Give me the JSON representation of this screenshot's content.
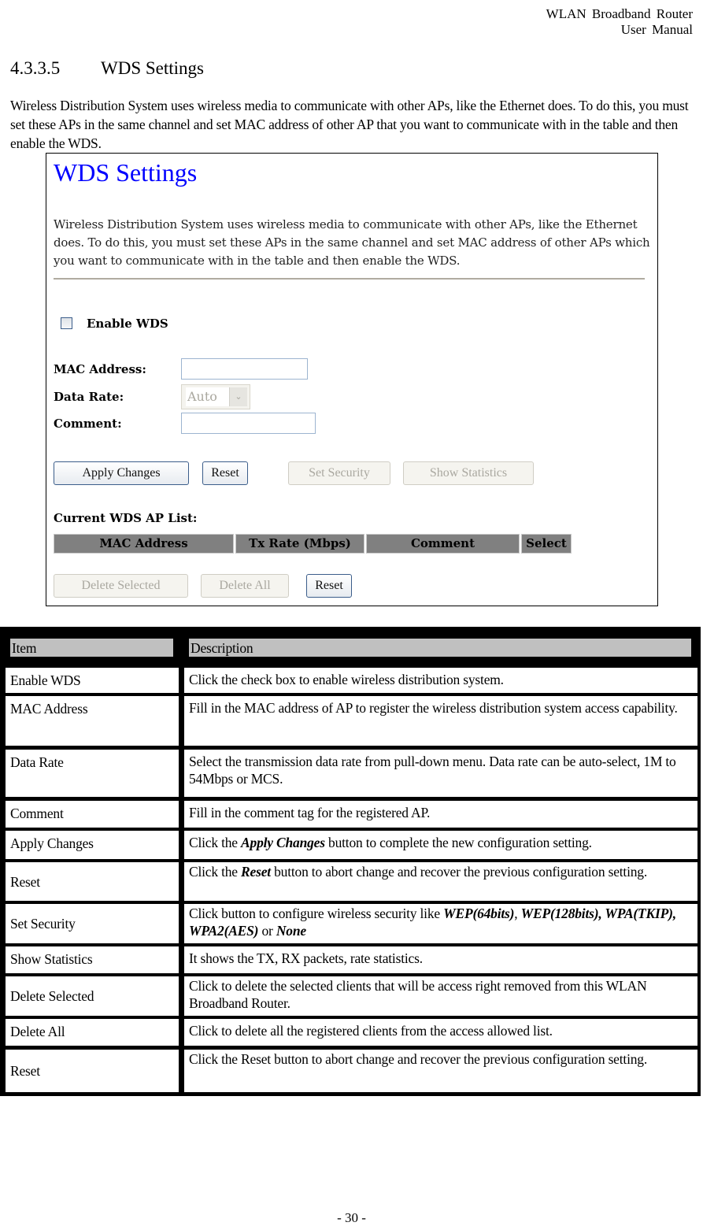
{
  "running_header": {
    "line1": "WLAN  Broadband  Router",
    "line2": "User  Manual"
  },
  "section": {
    "number": "4.3.3.5",
    "title": "WDS Settings"
  },
  "intro": "Wireless Distribution System uses wireless media to communicate with other APs, like the Ethernet does. To do this, you must set these APs in the same channel and set MAC address of other AP that you want to communicate with in the table and then enable the WDS.",
  "screenshot": {
    "title": "WDS Settings",
    "description": "Wireless Distribution System uses wireless media to communicate with other APs, like the Ethernet does. To do this, you must set these APs in the same channel and set MAC address of other APs which you want to communicate with in the table and then enable the WDS.",
    "enable_wds": {
      "label": "Enable WDS",
      "checked": false
    },
    "fields": {
      "mac_address": {
        "label": "MAC Address:",
        "value": ""
      },
      "data_rate": {
        "label": "Data Rate:",
        "selected": "Auto",
        "disabled": true
      },
      "comment": {
        "label": "Comment:",
        "value": ""
      }
    },
    "buttons": {
      "apply_changes": "Apply Changes",
      "reset": "Reset",
      "set_security": "Set Security",
      "show_statistics": "Show Statistics"
    },
    "ap_list": {
      "label": "Current WDS AP List:",
      "columns": [
        "MAC Address",
        "Tx Rate (Mbps)",
        "Comment",
        "Select"
      ],
      "rows": []
    },
    "list_buttons": {
      "delete_selected": "Delete Selected",
      "delete_all": "Delete All",
      "reset": "Reset"
    },
    "colors": {
      "title": "#0000ff",
      "list_header_bg": "#808080"
    }
  },
  "table": {
    "headers": {
      "item": "Item",
      "description": "Description"
    },
    "rows": [
      {
        "item": "Enable WDS",
        "description": [
          "Click the check box to enable wireless distribution system."
        ]
      },
      {
        "item": "MAC Address",
        "description": [
          "Fill in the MAC address of AP to register the wireless distribution system access capability."
        ]
      },
      {
        "item": "Data Rate",
        "description": [
          "Select the transmission data rate from pull-down menu. Data rate can be auto-select, 1M to 54Mbps or MCS."
        ]
      },
      {
        "item": "Comment",
        "description": [
          "Fill in the comment tag for the registered AP."
        ]
      },
      {
        "item": "Apply Changes",
        "description": [
          "Click the ",
          "Apply Changes",
          " button to complete the new configuration setting."
        ]
      },
      {
        "item": "Reset",
        "description": [
          "Click the ",
          "Reset",
          " button to abort change and recover the previous configuration setting."
        ]
      },
      {
        "item": "Set Security",
        "description": [
          "Click button to configure wireless security like ",
          "WEP(64bits)",
          ", ",
          "WEP(128bits), WPA(TKIP), WPA2(AES)",
          " or ",
          "None"
        ]
      },
      {
        "item": "Show Statistics",
        "description": [
          "It shows the TX, RX packets, rate statistics."
        ]
      },
      {
        "item": "Delete Selected",
        "description": [
          "Click to delete the selected clients that will be access right removed from this WLAN Broadband Router."
        ]
      },
      {
        "item": "Delete All",
        "description": [
          "Click to delete all the registered clients from the access allowed list."
        ]
      },
      {
        "item": "Reset",
        "description": [
          "Click the Reset button to abort change and recover the previous configuration setting."
        ]
      }
    ]
  },
  "page_number": "- 30 -"
}
